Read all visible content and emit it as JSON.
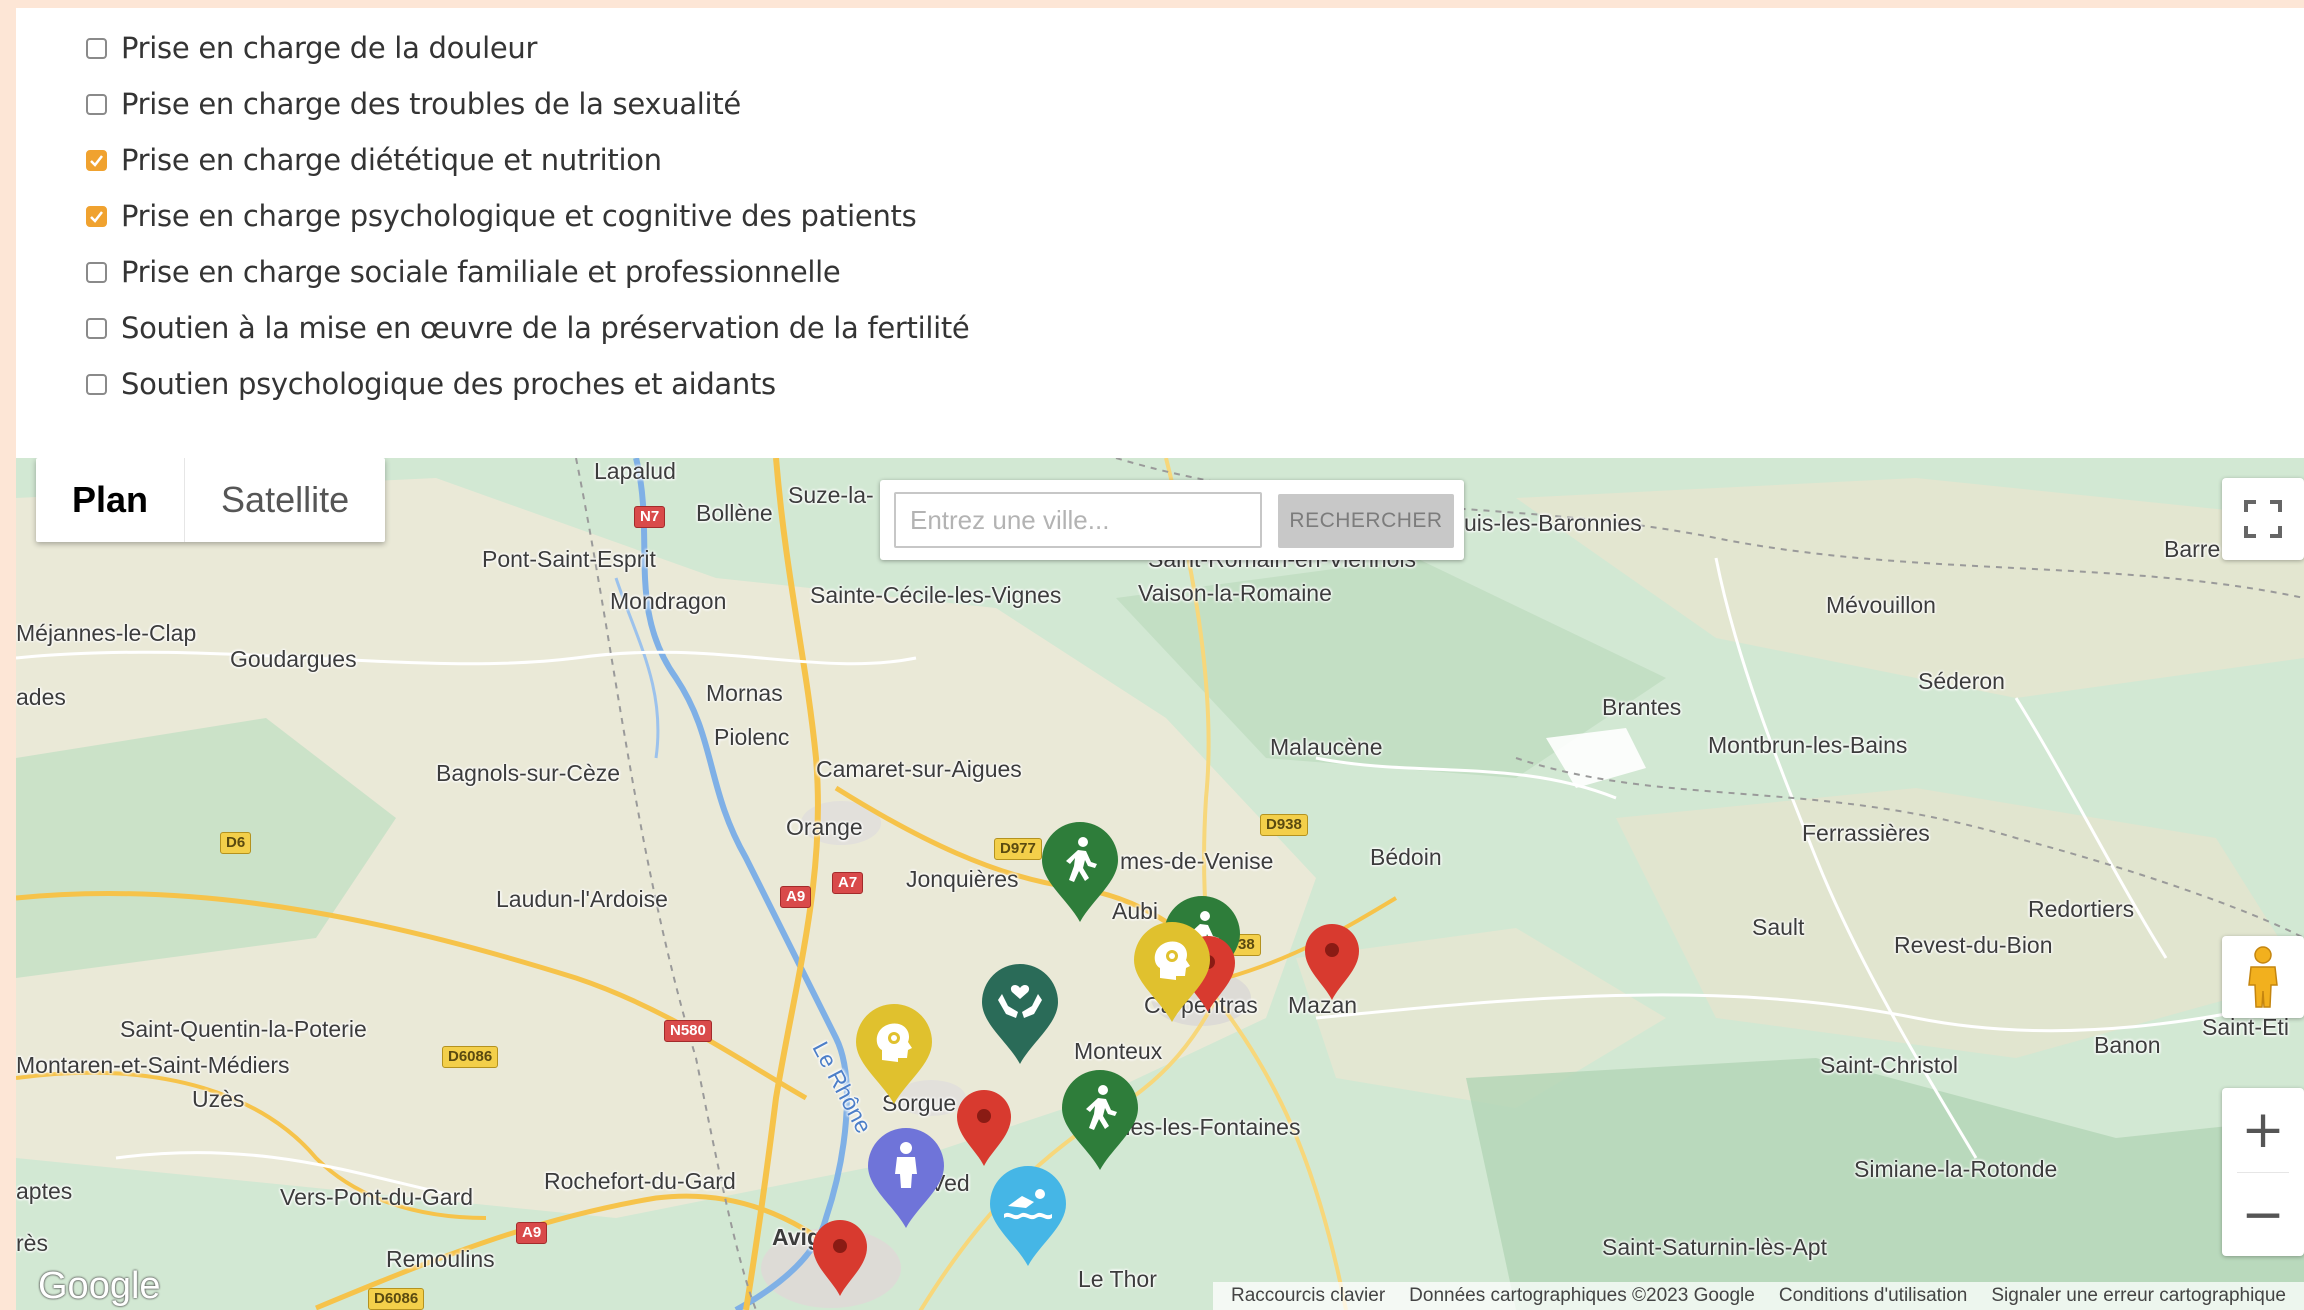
{
  "filters": [
    {
      "label": "Prise en charge de la douleur",
      "checked": false
    },
    {
      "label": "Prise en charge des troubles de la sexualité",
      "checked": false
    },
    {
      "label": "Prise en charge diététique et nutrition",
      "checked": true
    },
    {
      "label": "Prise en charge psychologique et cognitive des patients",
      "checked": true
    },
    {
      "label": "Prise en charge sociale familiale et professionnelle",
      "checked": false
    },
    {
      "label": "Soutien à la mise en œuvre de la préservation de la fertilité",
      "checked": false
    },
    {
      "label": "Soutien psychologique des proches et aidants",
      "checked": false
    }
  ],
  "map": {
    "type_control": {
      "plan_label": "Plan",
      "satellite_label": "Satellite",
      "active": "Plan"
    },
    "search": {
      "placeholder": "Entrez une ville...",
      "button_label": "RECHERCHER"
    },
    "places": [
      "Lapalud",
      "Bollène",
      "Suze-la-",
      "uis-les-Baronnies",
      "Pont-Saint-Esprit",
      "Saint-Romain-en-Viennois",
      "Barre",
      "Mondragon",
      "Sainte-Cécile-les-Vignes",
      "Vaison-la-Romaine",
      "Méjannes-le-Clap",
      "Mévouillon",
      "Goudargues",
      "Mornas",
      "Séderon",
      "ades",
      "Brantes",
      "Piolenc",
      "Malaucène",
      "Montbrun-les-Bains",
      "Camaret-sur-Aigues",
      "Bagnols-sur-Cèze",
      "Orange",
      "Ferrassières",
      "mes-de-Venise",
      "Bédoin",
      "Jonquières",
      "Laudun-l'Ardoise",
      "Redortiers",
      "Aubi",
      "Sault",
      "Revest-du-Bion",
      "Carpentras",
      "Mazan",
      "Saint-Quentin-la-Poterie",
      "Saint-Eti",
      "Montaren-et-Saint-Médiers",
      "Monteux",
      "Banon",
      "Uzès",
      "Le Rhône",
      "Saint-Christol",
      "Sorgue",
      "rnes-les-Fontaines",
      "Rochefort-du-Gard",
      "Simiane-la-Rotonde",
      "Ved",
      "aptes",
      "Vers-Pont-du-Gard",
      "Avignon",
      "rès",
      "Saint-Saturnin-lès-Apt",
      "Remoulins",
      "Le Thor"
    ],
    "roads": [
      "N7",
      "D977",
      "D938",
      "D6",
      "A9",
      "A7",
      "N580",
      "D6086",
      "A9",
      "D6086",
      "38"
    ],
    "markers": [
      {
        "color": "#2e7d3a",
        "icon": "walking-person-icon"
      },
      {
        "color": "#2e7d3a",
        "icon": "walking-person-icon"
      },
      {
        "color": "#e0c12e",
        "icon": "head-gear-icon"
      },
      {
        "color": "#d83a2f",
        "icon": "pin-dot-icon"
      },
      {
        "color": "#d83a2f",
        "icon": "pin-dot-icon"
      },
      {
        "color": "#2a6b58",
        "icon": "hands-heart-icon"
      },
      {
        "color": "#e0c12e",
        "icon": "head-gear-icon"
      },
      {
        "color": "#2e7d3a",
        "icon": "walking-person-icon"
      },
      {
        "color": "#d83a2f",
        "icon": "pin-dot-icon"
      },
      {
        "color": "#6f74d9",
        "icon": "person-icon"
      },
      {
        "color": "#45b6e6",
        "icon": "swimmer-icon"
      },
      {
        "color": "#d83a2f",
        "icon": "pin-dot-icon"
      }
    ],
    "logo_text": "Google",
    "attribution": {
      "shortcuts": "Raccourcis clavier",
      "data": "Données cartographiques ©2023 Google",
      "terms": "Conditions d'utilisation",
      "report": "Signaler une erreur cartographique"
    },
    "controls": {
      "zoom_in": "+",
      "zoom_out": "−"
    }
  },
  "colors": {
    "accent": "#f0a22f",
    "page_bg": "#fde6d6"
  }
}
